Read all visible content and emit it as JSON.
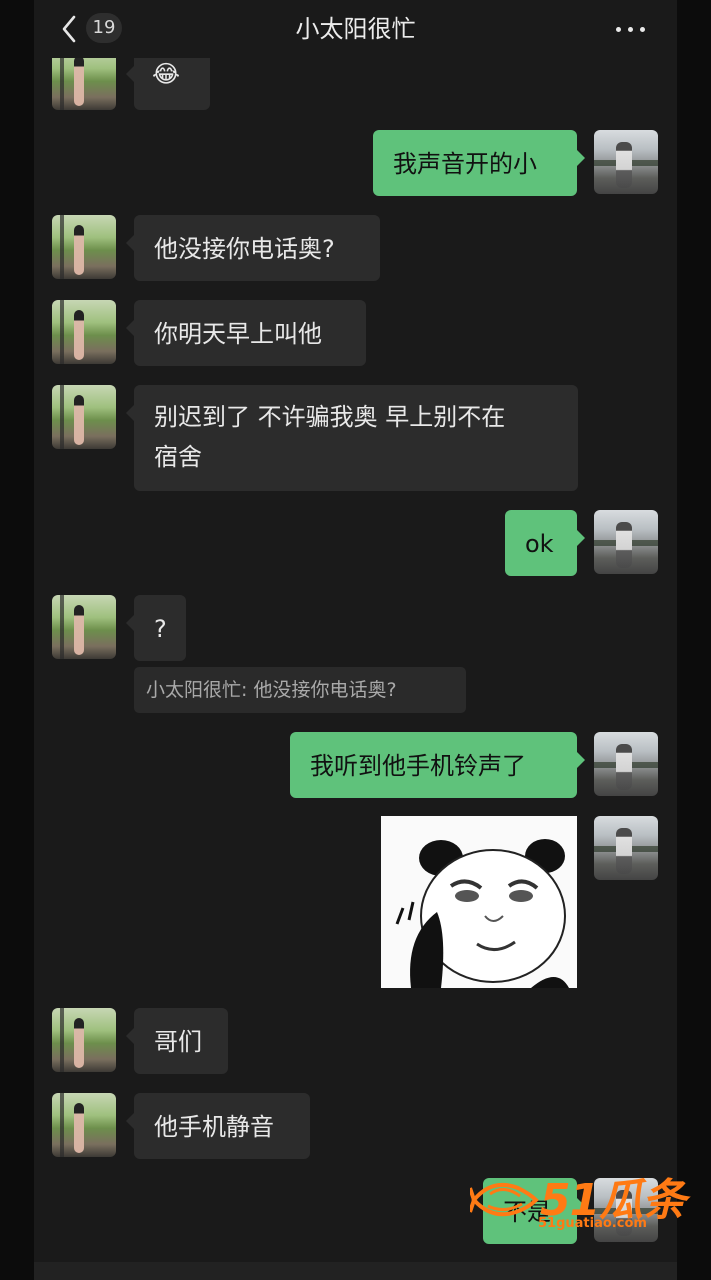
{
  "header": {
    "title": "小太阳很忙",
    "unread_count": "19",
    "back_icon": "chevron-left-icon",
    "more_icon": "more-dots-icon"
  },
  "messages": {
    "m0": {
      "sender": "contact",
      "text": "😂"
    },
    "m1": {
      "sender": "me",
      "text": "我声音开的小"
    },
    "m2": {
      "sender": "contact",
      "text": "他没接你电话奥?"
    },
    "m3": {
      "sender": "contact",
      "text": "你明天早上叫他"
    },
    "m4": {
      "sender": "contact",
      "line1": "别迟到了 不许骗我奥 早上别不在",
      "line2": "宿舍"
    },
    "m5": {
      "sender": "me",
      "text": "ok"
    },
    "m6": {
      "sender": "contact",
      "text": "?",
      "quote": "小太阳很忙: 他没接你电话奥?"
    },
    "m7": {
      "sender": "me",
      "text": "我听到他手机铃声了"
    },
    "m8": {
      "sender": "me",
      "type": "sticker",
      "sticker": "panda-meme-sticker"
    },
    "m9": {
      "sender": "contact",
      "text": "哥们"
    },
    "m10": {
      "sender": "contact",
      "text": "他手机静音"
    },
    "m11": {
      "sender": "me",
      "text": "不是"
    }
  },
  "watermark": {
    "brand": "51瓜条",
    "url": "51guatiao.com"
  },
  "colors": {
    "background": "#1a1a1a",
    "incoming_bubble": "#2c2c2c",
    "outgoing_bubble": "#5fc27b",
    "watermark": "#ff7a14"
  }
}
